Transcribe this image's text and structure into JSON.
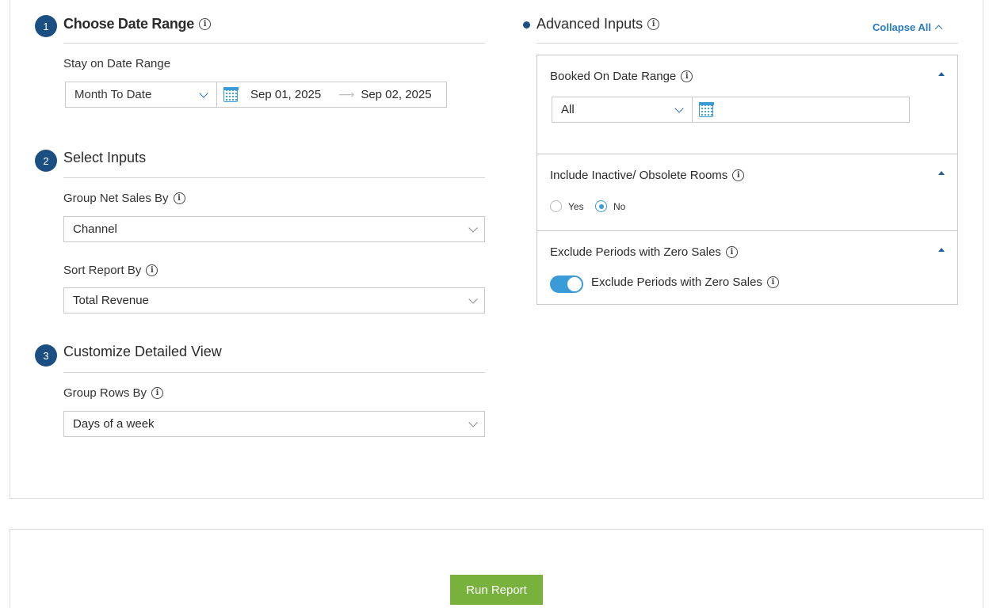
{
  "step1": {
    "number": "1",
    "title": "Choose Date Range",
    "stay_label": "Stay on Date Range",
    "preset": "Month To Date",
    "start_date": "Sep 01, 2025",
    "end_date": "Sep 02, 2025"
  },
  "step2": {
    "number": "2",
    "title": "Select Inputs",
    "group_label": "Group Net Sales By",
    "group_value": "Channel",
    "sort_label": "Sort Report By",
    "sort_value": "Total Revenue"
  },
  "step3": {
    "number": "3",
    "title": "Customize Detailed View",
    "rows_label": "Group Rows By",
    "rows_value": "Days of a week"
  },
  "advanced": {
    "title": "Advanced Inputs",
    "collapse_all": "Collapse All",
    "booked": {
      "title": "Booked On Date Range",
      "value": "All"
    },
    "inactive": {
      "title": "Include Inactive/ Obsolete Rooms",
      "yes": "Yes",
      "no": "No",
      "selected": "No"
    },
    "zero_sales": {
      "title": "Exclude Periods with Zero Sales",
      "toggle_label": "Exclude Periods with Zero Sales",
      "enabled": true
    }
  },
  "actions": {
    "run_report": "Run Report"
  },
  "colors": {
    "step_badge": "#1b4f82",
    "accent_blue": "#3a9bd9",
    "link_blue": "#2a7ac0",
    "run_green": "#78b13b"
  },
  "icons": [
    "info-icon",
    "calendar-icon",
    "chevron-down-icon",
    "chevron-up-icon",
    "caret-up-icon",
    "arrow-right-icon"
  ]
}
